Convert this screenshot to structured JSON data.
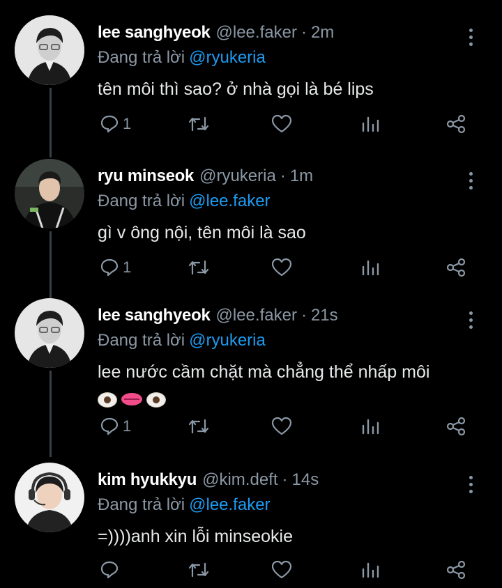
{
  "colors": {
    "background": "#000000",
    "text": "#e7e9ea",
    "muted": "#8b98a5",
    "mention": "#1d9bf0",
    "thread_line": "#3a3f44"
  },
  "icons": {
    "reply": "reply-icon",
    "retweet": "retweet-icon",
    "like": "heart-icon",
    "views": "analytics-icon",
    "share": "share-icon",
    "more": "more-vertical-icon"
  },
  "tweets": [
    {
      "name": "lee sanghyeok",
      "handle": "@lee.faker",
      "dot": "·",
      "time": "2m",
      "reply_prefix": "Đang trả lời",
      "reply_to": "@ryukeria",
      "text": "tên môi thì sao? ở nhà gọi là bé lips",
      "reply_count": "1"
    },
    {
      "name": "ryu minseok",
      "handle": "@ryukeria",
      "dot": "·",
      "time": "1m",
      "reply_prefix": "Đang trả lời",
      "reply_to": "@lee.faker",
      "text": "gì v ông nội, tên môi là sao",
      "reply_count": "1"
    },
    {
      "name": "lee sanghyeok",
      "handle": "@lee.faker",
      "dot": "·",
      "time": "21s",
      "reply_prefix": "Đang trả lời",
      "reply_to": "@ryukeria",
      "text": "lee nước cầm chặt mà chẳng thể nhấp môi",
      "emoji": "👁️👄👁️",
      "reply_count": "1"
    },
    {
      "name": "kim hyukkyu",
      "handle": "@kim.deft",
      "dot": "·",
      "time": "14s",
      "reply_prefix": "Đang trả lời",
      "reply_to": "@lee.faker",
      "text": "=))))anh xin lỗi minseokie",
      "reply_count": ""
    }
  ]
}
